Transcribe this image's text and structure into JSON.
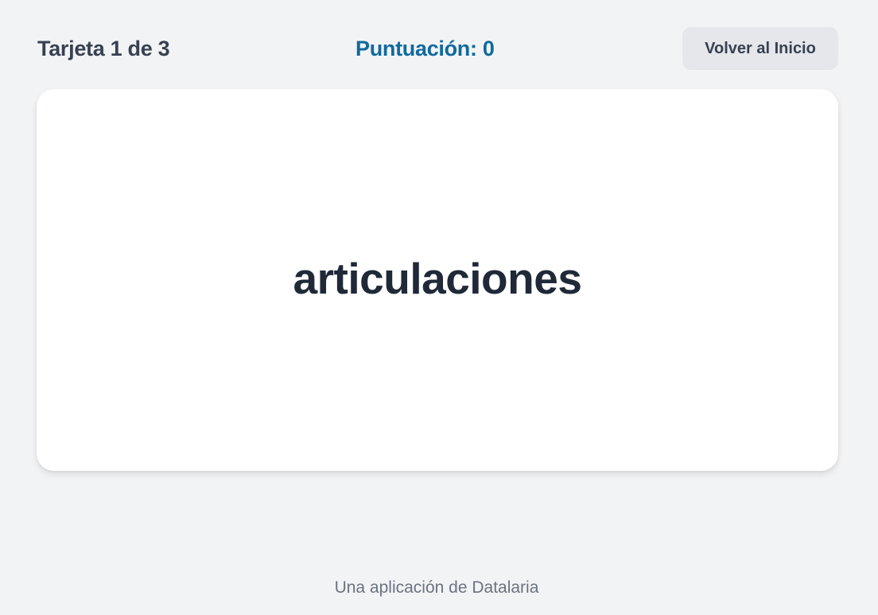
{
  "header": {
    "card_counter": "Tarjeta 1 de 3",
    "score": "Puntuación: 0",
    "home_button_label": "Volver al Inicio"
  },
  "card": {
    "word": "articulaciones"
  },
  "footer": {
    "text": "Una aplicación de Datalaria"
  },
  "colors": {
    "background": "#f2f3f5",
    "score_accent": "#0f6a9e",
    "card_background": "#ffffff",
    "button_background": "#e5e7eb"
  }
}
